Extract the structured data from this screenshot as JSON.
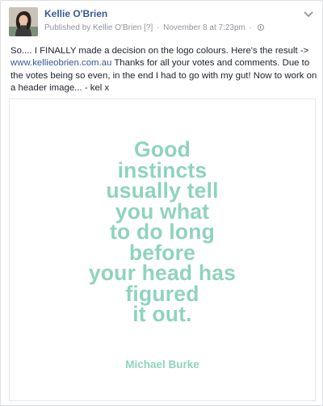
{
  "post": {
    "author": "Kellie O'Brien",
    "published_by_prefix": "Published by",
    "published_by_name": "Kellie O'Brien",
    "help_marker": "[?]",
    "separator": "·",
    "timestamp": "November 8 at 7:23pm",
    "separator2": "·",
    "privacy_icon": "globe-icon",
    "body_before_link": "So.... I FINALLY made a decision on the logo colours. Here's the result -> ",
    "link_text": "www.kellieobrien.com.au",
    "body_after_link": " Thanks for all your votes and comments. Due to the votes being so even, in the end I had to go with my gut! Now to work on a header image... - kel x"
  },
  "quote_image": {
    "lines": [
      "Good",
      "instincts",
      "usually tell",
      "you what",
      "to do long",
      "before",
      "your head has",
      "figured",
      "it out."
    ],
    "attribution": "Michael Burke",
    "text_color": "#8fd3bf"
  },
  "colors": {
    "link": "#365899",
    "body_text": "#1d2129",
    "meta": "#90949c"
  }
}
